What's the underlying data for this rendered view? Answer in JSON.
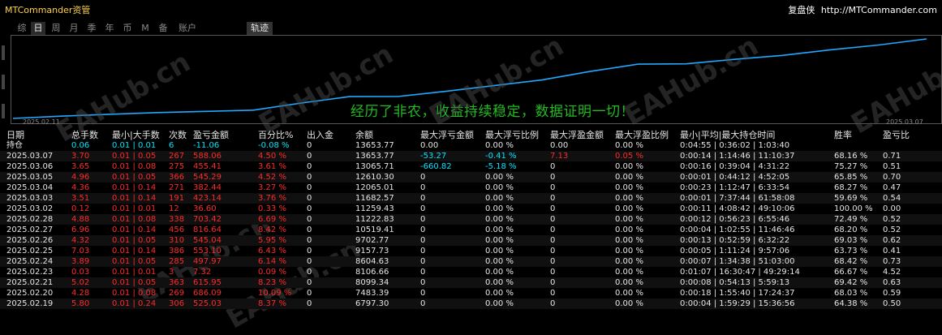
{
  "window": {
    "title": "MTCommander资管",
    "brand_name": "复盘侠",
    "brand_url": "http://MTCommander.com"
  },
  "tabs": [
    "综",
    "日",
    "周",
    "月",
    "季",
    "年",
    "币",
    "M",
    "备",
    "账户"
  ],
  "tab_track": "轨迹",
  "chart": {
    "start_label": "2025.02.11",
    "end_label": "2025.03.07",
    "slogan": "经历了非农，收益持续稳定，数据证明一切！",
    "line_color": "#1fa9ff",
    "watermark": "EAHub.cn"
  },
  "chart_data": {
    "type": "line",
    "x": [
      "2025.02.11",
      "2025.02.12",
      "2025.02.13",
      "2025.02.14",
      "2025.02.17",
      "2025.02.18",
      "2025.02.19",
      "2025.02.20",
      "2025.02.21",
      "2025.02.23",
      "2025.02.24",
      "2025.02.25",
      "2025.02.26",
      "2025.02.27",
      "2025.02.28",
      "2025.03.02",
      "2025.03.03",
      "2025.03.04",
      "2025.03.05",
      "2025.03.06",
      "2025.03.07"
    ],
    "y": [
      6000,
      6220,
      6400,
      6560,
      6680,
      6797.3,
      7483.39,
      8099.34,
      8106.66,
      8604.63,
      9157.73,
      9702.77,
      10519.41,
      11222.83,
      11259.43,
      11682.57,
      12065.01,
      12610.3,
      13065.71,
      13653.77
    ]
  },
  "table": {
    "headers": [
      "日期",
      "总手数",
      "最小|大手数",
      "次数",
      "盈亏金额",
      "百分比%",
      "出入金",
      "余额",
      "最大浮亏金额",
      "最大浮亏比例",
      "最大浮盈金额",
      "最大浮盈比例",
      "最小|平均|最大持仓时间",
      "胜率",
      "盈亏比"
    ],
    "holding": {
      "label": "持仓",
      "lots": "0.06",
      "minmax": "0.01 | 0.01",
      "count": "6",
      "pnl": "-11.06",
      "pct": "-0.08 %",
      "io": "0",
      "balance": "13653.77",
      "mfl": "0.00",
      "mflp": "0.00 %",
      "mfp": "0.00",
      "mfpp": "0.00 %",
      "time": "0:04:55 | 0:36:02 | 1:03:40",
      "win": "",
      "pf": ""
    },
    "rows": [
      {
        "date": "2025.03.07",
        "lots": "3.70",
        "minmax": "0.01 | 0.05",
        "count": "267",
        "pnl": "588.06",
        "pct": "4.50 %",
        "io": "0",
        "balance": "13653.77",
        "mfl": "-53.27",
        "mflp": "-0.41 %",
        "mfp": "7.13",
        "mfpp": "0.05 %",
        "time": "0:00:14 | 1:14:46 | 11:10:37",
        "win": "68.16 %",
        "pf": "0.71"
      },
      {
        "date": "2025.03.06",
        "lots": "3.65",
        "minmax": "0.01 | 0.08",
        "count": "275",
        "pnl": "455.41",
        "pct": "3.61 %",
        "io": "0",
        "balance": "13065.71",
        "mfl": "-660.82",
        "mflp": "-5.18 %",
        "mfp": "0",
        "mfpp": "0.00 %",
        "time": "0:00:16 | 0:39:04 | 4:31:22",
        "win": "75.27 %",
        "pf": "0.51"
      },
      {
        "date": "2025.03.05",
        "lots": "4.96",
        "minmax": "0.01 | 0.05",
        "count": "366",
        "pnl": "545.29",
        "pct": "4.52 %",
        "io": "0",
        "balance": "12610.30",
        "mfl": "0",
        "mflp": "0.00 %",
        "mfp": "0",
        "mfpp": "0.00 %",
        "time": "0:00:01 | 0:44:12 | 4:52:05",
        "win": "65.85 %",
        "pf": "0.70"
      },
      {
        "date": "2025.03.04",
        "lots": "4.36",
        "minmax": "0.01 | 0.14",
        "count": "271",
        "pnl": "382.44",
        "pct": "3.27 %",
        "io": "0",
        "balance": "12065.01",
        "mfl": "0",
        "mflp": "0.00 %",
        "mfp": "0",
        "mfpp": "0.00 %",
        "time": "0:00:23 | 1:12:47 | 6:33:54",
        "win": "68.27 %",
        "pf": "0.47"
      },
      {
        "date": "2025.03.03",
        "lots": "3.51",
        "minmax": "0.01 | 0.14",
        "count": "191",
        "pnl": "423.14",
        "pct": "3.76 %",
        "io": "0",
        "balance": "11682.57",
        "mfl": "0",
        "mflp": "0.00 %",
        "mfp": "0",
        "mfpp": "0.00 %",
        "time": "0:00:01 | 7:37:44 | 61:58:08",
        "win": "59.69 %",
        "pf": "0.54"
      },
      {
        "date": "2025.03.02",
        "lots": "0.12",
        "minmax": "0.01 | 0.01",
        "count": "12",
        "pnl": "36.60",
        "pct": "0.33 %",
        "io": "0",
        "balance": "11259.43",
        "mfl": "0",
        "mflp": "0.00 %",
        "mfp": "0",
        "mfpp": "0.00 %",
        "time": "0:00:11 | 4:08:42 | 49:10:06",
        "win": "100.00 %",
        "pf": "0.00"
      },
      {
        "date": "2025.02.28",
        "lots": "4.88",
        "minmax": "0.01 | 0.08",
        "count": "338",
        "pnl": "703.42",
        "pct": "6.69 %",
        "io": "0",
        "balance": "11222.83",
        "mfl": "0",
        "mflp": "0.00 %",
        "mfp": "0",
        "mfpp": "0.00 %",
        "time": "0:00:12 | 0:56:23 | 6:55:46",
        "win": "72.49 %",
        "pf": "0.52"
      },
      {
        "date": "2025.02.27",
        "lots": "6.96",
        "minmax": "0.01 | 0.14",
        "count": "456",
        "pnl": "816.64",
        "pct": "8.42 %",
        "io": "0",
        "balance": "10519.41",
        "mfl": "0",
        "mflp": "0.00 %",
        "mfp": "0",
        "mfpp": "0.00 %",
        "time": "0:00:04 | 1:02:55 | 11:46:46",
        "win": "68.20 %",
        "pf": "0.52"
      },
      {
        "date": "2025.02.26",
        "lots": "4.32",
        "minmax": "0.01 | 0.05",
        "count": "310",
        "pnl": "545.04",
        "pct": "5.95 %",
        "io": "0",
        "balance": "9702.77",
        "mfl": "0",
        "mflp": "0.00 %",
        "mfp": "0",
        "mfpp": "0.00 %",
        "time": "0:00:13 | 0:52:59 | 6:32:22",
        "win": "69.03 %",
        "pf": "0.62"
      },
      {
        "date": "2025.02.25",
        "lots": "7.03",
        "minmax": "0.01 | 0.14",
        "count": "386",
        "pnl": "553.10",
        "pct": "6.43 %",
        "io": "0",
        "balance": "9157.73",
        "mfl": "0",
        "mflp": "0.00 %",
        "mfp": "0",
        "mfpp": "0.00 %",
        "time": "0:00:05 | 1:11:24 | 9:57:06",
        "win": "63.73 %",
        "pf": "0.41"
      },
      {
        "date": "2025.02.24",
        "lots": "3.89",
        "minmax": "0.01 | 0.05",
        "count": "285",
        "pnl": "497.97",
        "pct": "6.14 %",
        "io": "0",
        "balance": "8604.63",
        "mfl": "0",
        "mflp": "0.00 %",
        "mfp": "0",
        "mfpp": "0.00 %",
        "time": "0:00:07 | 1:34:38 | 51:03:00",
        "win": "68.42 %",
        "pf": "0.73"
      },
      {
        "date": "2025.02.23",
        "lots": "0.03",
        "minmax": "0.01 | 0.01",
        "count": "3",
        "pnl": "7.32",
        "pct": "0.09 %",
        "io": "0",
        "balance": "8106.66",
        "mfl": "0",
        "mflp": "0.00 %",
        "mfp": "0",
        "mfpp": "0.00 %",
        "time": "0:01:07 | 16:30:47 | 49:29:14",
        "win": "66.67 %",
        "pf": "4.52"
      },
      {
        "date": "2025.02.21",
        "lots": "5.02",
        "minmax": "0.01 | 0.05",
        "count": "363",
        "pnl": "615.95",
        "pct": "8.23 %",
        "io": "0",
        "balance": "8099.34",
        "mfl": "0",
        "mflp": "0.00 %",
        "mfp": "0",
        "mfpp": "0.00 %",
        "time": "0:00:08 | 0:54:13 | 5:59:13",
        "win": "69.42 %",
        "pf": "0.63"
      },
      {
        "date": "2025.02.20",
        "lots": "4.28",
        "minmax": "0.01 | 0.08",
        "count": "269",
        "pnl": "686.09",
        "pct": "10.09 %",
        "io": "0",
        "balance": "7483.39",
        "mfl": "0",
        "mflp": "0.00 %",
        "mfp": "0",
        "mfpp": "0.00 %",
        "time": "0:00:18 | 1:55:40 | 17:24:37",
        "win": "68.03 %",
        "pf": "0.59"
      },
      {
        "date": "2025.02.19",
        "lots": "5.80",
        "minmax": "0.01 | 0.24",
        "count": "306",
        "pnl": "525.03",
        "pct": "8.37 %",
        "io": "0",
        "balance": "6797.30",
        "mfl": "0",
        "mflp": "0.00 %",
        "mfp": "0",
        "mfpp": "0.00 %",
        "time": "0:00:04 | 1:59:29 | 15:36:56",
        "win": "64.38 %",
        "pf": "0.50"
      }
    ]
  },
  "colors": {
    "profit": "#ff2a2a",
    "accent": "#00e5ff",
    "text": "#e6e6e6",
    "slogan": "#22bb22",
    "title": "#ffd24a"
  }
}
